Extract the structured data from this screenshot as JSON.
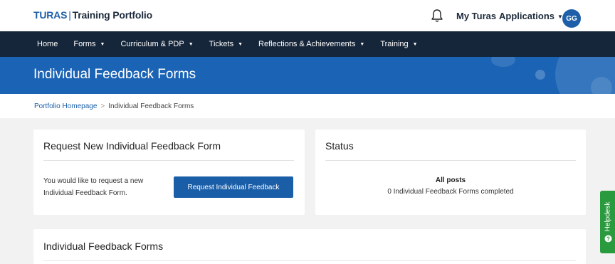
{
  "header": {
    "brand_main": "TURAS",
    "brand_separator": "|",
    "brand_product": "Training Portfolio",
    "my_turas": "My Turas",
    "applications": "Applications",
    "avatar_initials": "GG"
  },
  "nav": {
    "items": [
      {
        "label": "Home",
        "has_caret": false
      },
      {
        "label": "Forms",
        "has_caret": true
      },
      {
        "label": "Curriculum & PDP",
        "has_caret": true
      },
      {
        "label": "Tickets",
        "has_caret": true
      },
      {
        "label": "Reflections & Achievements",
        "has_caret": true
      },
      {
        "label": "Training",
        "has_caret": true
      }
    ],
    "caret": "▼"
  },
  "banner": {
    "title": "Individual Feedback Forms"
  },
  "breadcrumb": {
    "home": "Portfolio Homepage",
    "separator": ">",
    "current": "Individual Feedback Forms"
  },
  "request_card": {
    "title": "Request New Individual Feedback Form",
    "text": "You would like to request a new Individual Feedback Form.",
    "button_label": "Request Individual Feedback"
  },
  "status_card": {
    "title": "Status",
    "heading": "All posts",
    "summary": "0 Individual Feedback Forms completed"
  },
  "forms_card": {
    "title": "Individual Feedback Forms"
  },
  "helpdesk": {
    "label": "Helpdesk",
    "icon_glyph": "?"
  },
  "colors": {
    "brand_blue": "#1d5fa8",
    "nav_bg": "#16263a",
    "banner_bg": "#1a63b5",
    "helpdesk_green": "#2a9a3e"
  },
  "icons": {
    "bell": "bell-icon",
    "caret": "chevron-down-icon",
    "help": "question-circle-icon"
  }
}
